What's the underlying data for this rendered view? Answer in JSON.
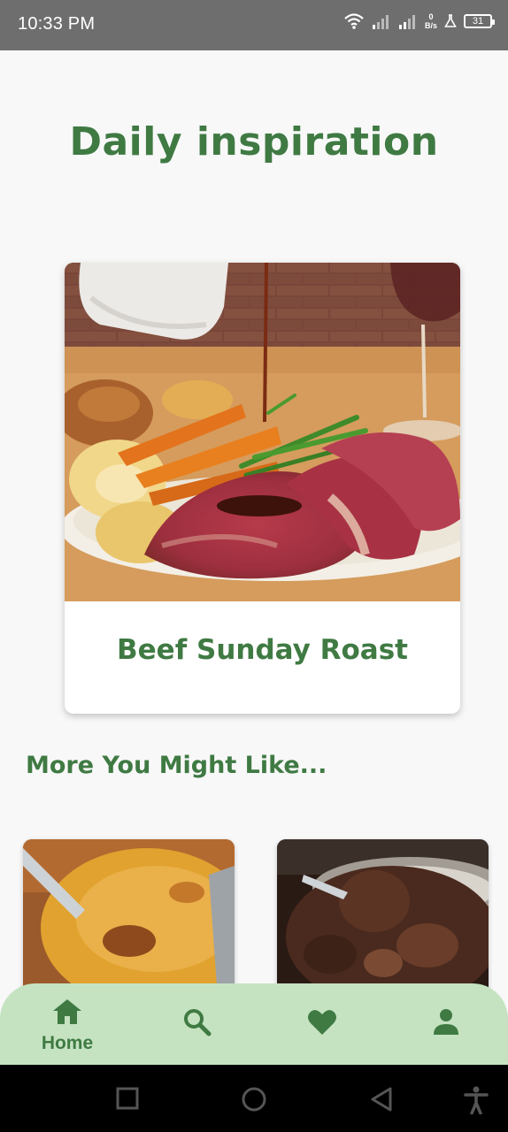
{
  "status_bar": {
    "time": "10:33 PM",
    "net_speed_value": "0",
    "net_speed_unit": "B/s",
    "battery_level": "31",
    "icons": [
      "wifi-icon",
      "signal-icon",
      "signal-icon",
      "lab-icon",
      "battery-icon"
    ]
  },
  "header": {
    "title": "Daily inspiration"
  },
  "featured": {
    "title": "Beef Sunday Roast"
  },
  "more_section": {
    "heading": "More You Might Like..."
  },
  "recipes": [
    {
      "icon": "recipe-image-baked"
    },
    {
      "icon": "recipe-image-stew"
    }
  ],
  "bottom_nav": {
    "items": [
      {
        "label": "Home",
        "icon": "home-icon",
        "active": true
      },
      {
        "label": "",
        "icon": "search-icon",
        "active": false
      },
      {
        "label": "",
        "icon": "heart-icon",
        "active": false
      },
      {
        "label": "",
        "icon": "person-icon",
        "active": false
      }
    ]
  },
  "colors": {
    "accent": "#3f7a43",
    "nav_background": "#c5e3c1",
    "page_background": "#f8f8f8",
    "status_bar": "#6e6e6e"
  },
  "system_nav": {
    "icons": [
      "square-icon",
      "circle-icon",
      "back-triangle-icon",
      "accessibility-icon"
    ]
  }
}
